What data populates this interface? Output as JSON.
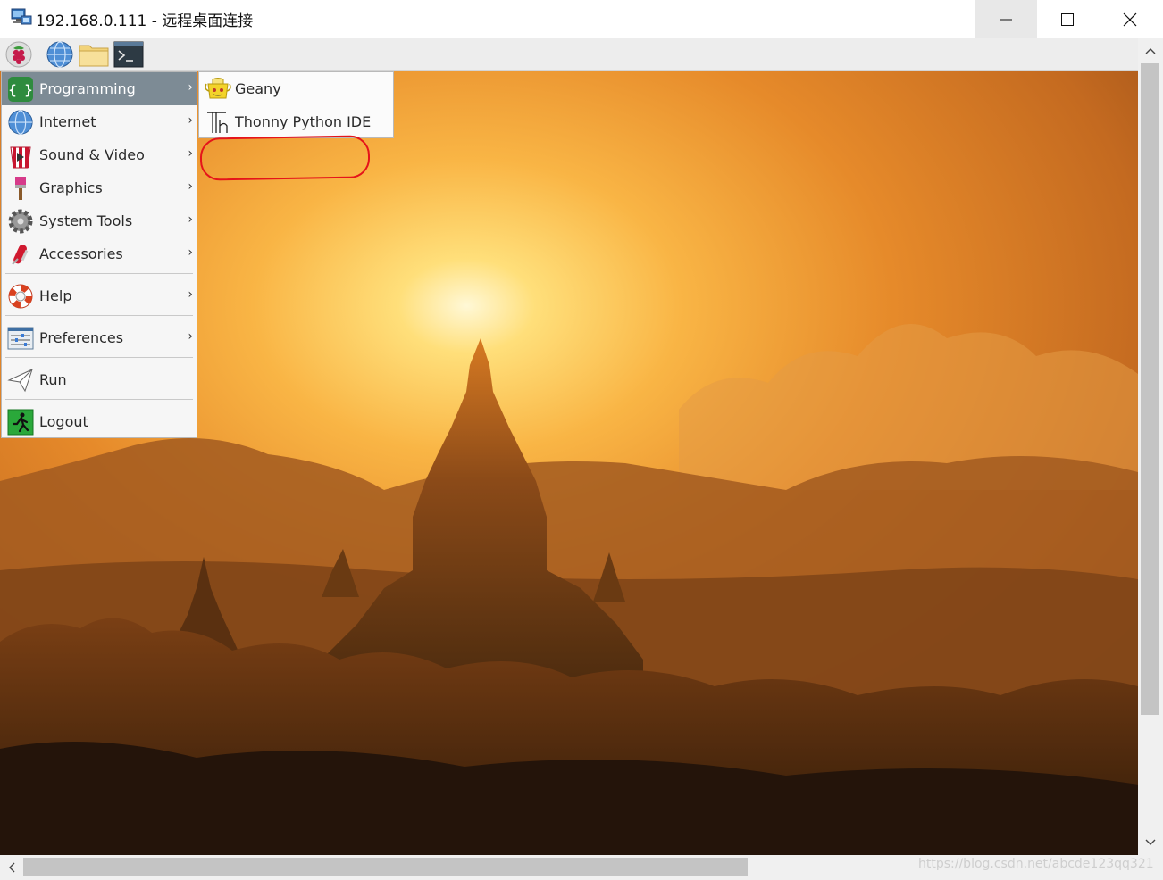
{
  "window": {
    "title": "192.168.0.111 - 远程桌面连接",
    "controls": [
      "minimize",
      "maximize",
      "close"
    ]
  },
  "panel": {
    "launchers": [
      "raspberry-menu-icon",
      "web-browser-icon",
      "file-manager-icon",
      "terminal-icon"
    ]
  },
  "menu": {
    "items": [
      {
        "label": "Programming",
        "icon": "programming-icon",
        "has_submenu": true,
        "active": true
      },
      {
        "label": "Internet",
        "icon": "globe-icon",
        "has_submenu": true
      },
      {
        "label": "Sound & Video",
        "icon": "popcorn-icon",
        "has_submenu": true
      },
      {
        "label": "Graphics",
        "icon": "paintbrush-icon",
        "has_submenu": true
      },
      {
        "label": "System Tools",
        "icon": "gear-icon",
        "has_submenu": true
      },
      {
        "label": "Accessories",
        "icon": "swiss-knife-icon",
        "has_submenu": true
      },
      {
        "label": "Help",
        "icon": "lifebuoy-icon",
        "has_submenu": true
      },
      {
        "label": "Preferences",
        "icon": "sliders-icon",
        "has_submenu": true
      },
      {
        "label": "Run",
        "icon": "paper-plane-icon",
        "has_submenu": false
      },
      {
        "label": "Logout",
        "icon": "exit-icon",
        "has_submenu": false
      }
    ],
    "arrow": "›"
  },
  "submenu": {
    "items": [
      {
        "label": "Geany",
        "icon": "geany-icon"
      },
      {
        "label": "Thonny Python IDE",
        "icon": "thonny-icon",
        "circled": true
      }
    ]
  },
  "scrollbars": {
    "up": "⌃",
    "down": "⌄",
    "left": "‹"
  },
  "watermark": "https://blog.csdn.net/abcde123qq321",
  "colors": {
    "active_item": "#7d8b95",
    "annotation": "#e5141a"
  }
}
